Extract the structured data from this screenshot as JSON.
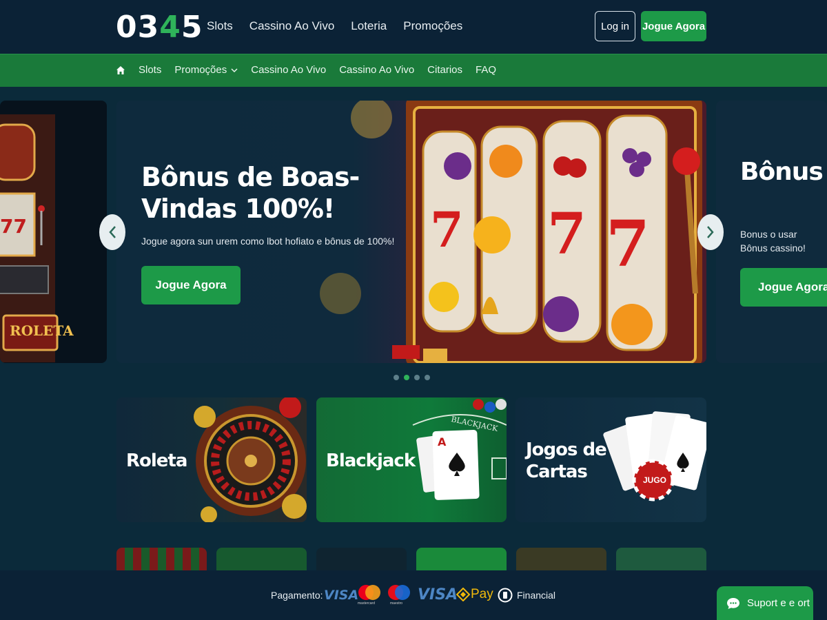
{
  "header": {
    "logo": {
      "part1": "03",
      "part2": "4",
      "part3": "5"
    },
    "nav": [
      "Slots",
      "Cassino Ao Vivo",
      "Loteria",
      "Promoções"
    ],
    "login_label": "Log in",
    "play_label": "Jogue Agora"
  },
  "subnav": {
    "items": [
      "Slots",
      "Promoções",
      "Cassino Ao Vivo",
      "Cassino Ao Vivo",
      "Citarios",
      "FAQ"
    ]
  },
  "carousel": {
    "left_slide": {
      "sign_label": "ROLETA"
    },
    "main_slide": {
      "title": "Bônus de Boas-Vindas 100%!",
      "subtitle": "Jogue agora sun urem como lbot hofiato e bônus de 100%!",
      "button_label": "Jogue Agora"
    },
    "right_slide": {
      "title": "Bônus de Boas-Vindas",
      "subtitle": "Bonus o usar Bônus cassino!",
      "button_label": "Jogue Agora"
    },
    "dots": 4,
    "active_dot": 1
  },
  "categories": [
    {
      "label": "Roleta"
    },
    {
      "label": "Blackjack",
      "table_text": "BLACKJACK"
    },
    {
      "label": "Jogos de Cartas",
      "chip_text": "JUGO"
    }
  ],
  "footer": {
    "payment_label": "Pagamento:",
    "methods": [
      "VISA",
      "mastercard",
      "maestro",
      "VISA",
      "Pay",
      "Financial"
    ],
    "support_label": "Suport e e ort"
  },
  "colors": {
    "brand_green": "#1d9a48",
    "header_bg": "#0b2236",
    "subnav_bg": "#1a7a3a",
    "page_bg": "#0b2a3a"
  },
  "icons": [
    "home-icon",
    "chevron-down-icon",
    "chevron-left-icon",
    "chevron-right-icon",
    "chat-icon"
  ]
}
